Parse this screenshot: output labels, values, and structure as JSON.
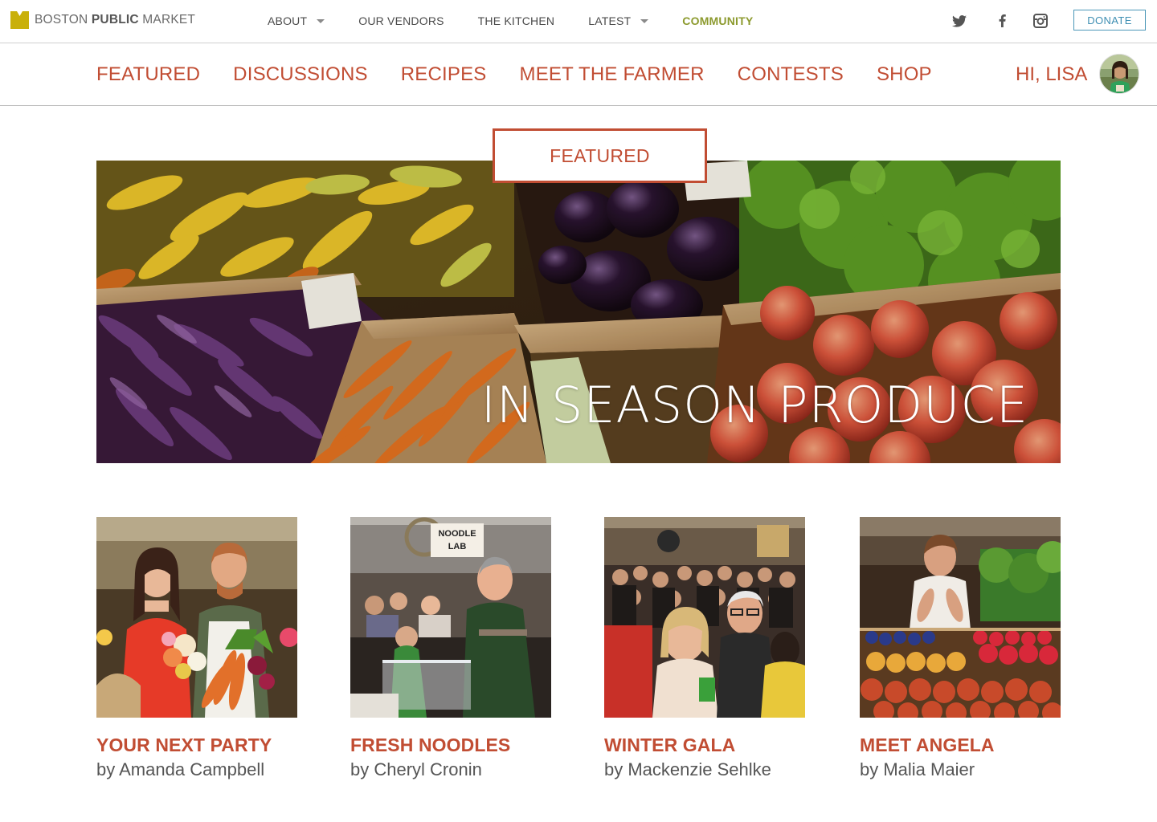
{
  "brand": {
    "name_light": "BOSTON ",
    "name_bold": "PUBLIC",
    "name_tail": " MARKET",
    "logo_color": "#c9b00b"
  },
  "main_nav": [
    {
      "label": "ABOUT",
      "dropdown": true
    },
    {
      "label": "OUR VENDORS",
      "dropdown": false
    },
    {
      "label": "THE KITCHEN",
      "dropdown": false
    },
    {
      "label": "LATEST",
      "dropdown": true
    },
    {
      "label": "COMMUNITY",
      "dropdown": false,
      "active": true
    }
  ],
  "social": {
    "icons": [
      "twitter-icon",
      "facebook-icon",
      "instagram-icon"
    ]
  },
  "donate_label": "DONATE",
  "sub_nav": [
    {
      "label": "FEATURED"
    },
    {
      "label": "DISCUSSIONS"
    },
    {
      "label": "RECIPES"
    },
    {
      "label": "MEET THE FARMER"
    },
    {
      "label": "CONTESTS"
    },
    {
      "label": "SHOP"
    }
  ],
  "user": {
    "greeting": "HI, LISA"
  },
  "featured": {
    "tab_label": "FEATURED",
    "hero_title": "IN SEASON PRODUCE"
  },
  "cards": [
    {
      "title": "YOUR NEXT PARTY",
      "author": "by Amanda Campbell"
    },
    {
      "title": "FRESH NOODLES",
      "author": "by Cheryl Cronin",
      "sign": "NOODLE LAB"
    },
    {
      "title": "WINTER GALA",
      "author": "by Mackenzie Sehlke"
    },
    {
      "title": "MEET ANGELA",
      "author": "by Malia Maier"
    }
  ],
  "colors": {
    "accent": "#c14d33",
    "community": "#8c9a2e",
    "donate": "#3f8fb3"
  }
}
